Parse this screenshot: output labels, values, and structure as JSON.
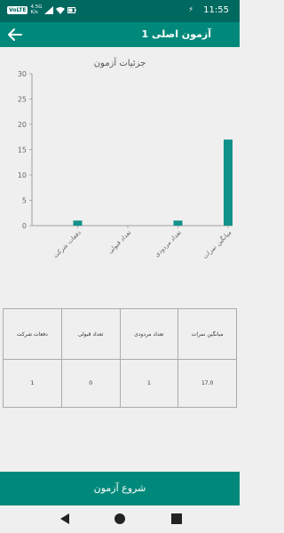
{
  "status": {
    "time": "11:55",
    "net_badge": "VoLTE",
    "net_speed_value": "4.5G",
    "net_speed_unit": "K/s",
    "notification": "⚡"
  },
  "header": {
    "title": "آزمون اصلی 1",
    "back_icon": "arrow-left-icon"
  },
  "chart_data": {
    "type": "bar",
    "title": "جزئیات آزمون",
    "categories": [
      "دفعات شرکت",
      "تعداد قبولی",
      "تعداد مردودی",
      "میانگین نمرات"
    ],
    "values": [
      1,
      0,
      1,
      17
    ],
    "ylim": [
      0,
      30
    ],
    "yticks": [
      0,
      5,
      10,
      15,
      20,
      25,
      30
    ],
    "color": "#12918a",
    "grid": false
  },
  "table": {
    "headers": [
      "دفعات شرکت",
      "تعداد قبولی",
      "تعداد مردودی",
      "میانگین نمرات"
    ],
    "values": [
      "1",
      "0",
      "1",
      "17.0"
    ]
  },
  "start_button": {
    "label": "شروع آزمون"
  },
  "nav": {
    "back_icon": "nav-back-icon",
    "home_icon": "nav-home-icon",
    "recents_icon": "nav-recents-icon"
  }
}
